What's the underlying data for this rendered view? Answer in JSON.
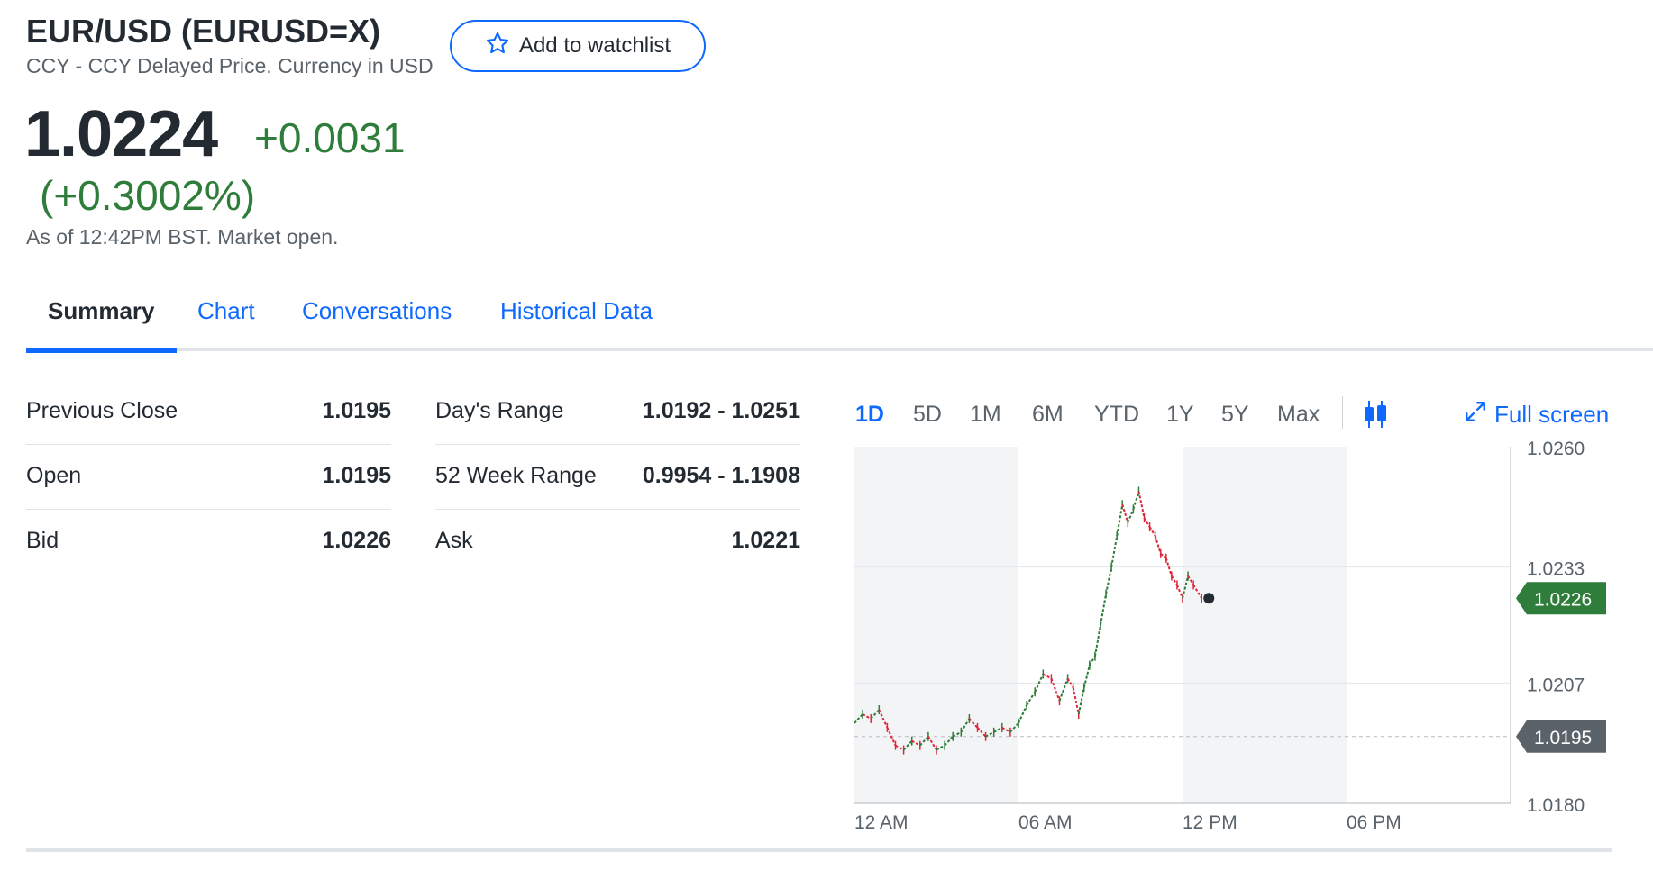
{
  "header": {
    "title": "EUR/USD (EURUSD=X)",
    "subtitle": "CCY - CCY Delayed Price. Currency in USD",
    "watchlist_label": "Add to watchlist",
    "price": "1.0224",
    "change": "+0.0031",
    "change_pct": "(+0.3002%)",
    "as_of": "As of 12:42PM BST. Market open.",
    "up_color": "#2f7d3a"
  },
  "tabs": [
    {
      "label": "Summary"
    },
    {
      "label": "Chart"
    },
    {
      "label": "Conversations"
    },
    {
      "label": "Historical Data"
    }
  ],
  "stats_left": [
    {
      "label": "Previous Close",
      "value": "1.0195"
    },
    {
      "label": "Open",
      "value": "1.0195"
    },
    {
      "label": "Bid",
      "value": "1.0226"
    }
  ],
  "stats_right": [
    {
      "label": "Day's Range",
      "value": "1.0192 - 1.0251"
    },
    {
      "label": "52 Week Range",
      "value": "0.9954 - 1.1908"
    },
    {
      "label": "Ask",
      "value": "1.0221"
    }
  ],
  "chart_toolbar": {
    "ranges": [
      "1D",
      "5D",
      "1M",
      "6M",
      "YTD",
      "1Y",
      "5Y",
      "Max"
    ],
    "active_range": "1D",
    "chart_type_icon": "candlestick-icon",
    "fullscreen_label": "Full screen"
  },
  "chart_data": {
    "type": "line",
    "xlabel": "",
    "ylabel": "",
    "x_ticks": [
      "12 AM",
      "06 AM",
      "12 PM",
      "06 PM"
    ],
    "y_ticks": [
      "1.0260",
      "1.0233",
      "1.0207",
      "1.0180"
    ],
    "ylim": [
      1.018,
      1.026
    ],
    "current_price_label": "1.0226",
    "previous_close_label": "1.0195",
    "current_price": 1.0226,
    "previous_close": 1.0195,
    "x_hours": [
      0,
      0.3,
      0.6,
      0.9,
      1.2,
      1.5,
      1.8,
      2.1,
      2.4,
      2.7,
      3.0,
      3.3,
      3.6,
      3.9,
      4.2,
      4.5,
      4.8,
      5.1,
      5.4,
      5.7,
      6.0,
      6.3,
      6.6,
      6.9,
      7.2,
      7.5,
      7.8,
      8.0,
      8.2,
      8.4,
      8.6,
      8.8,
      9.0,
      9.2,
      9.4,
      9.6,
      9.8,
      10.0,
      10.2,
      10.4,
      10.6,
      10.8,
      11.0,
      11.2,
      11.4,
      11.6,
      11.8,
      12.0,
      12.2,
      12.4,
      12.7
    ],
    "y_values": [
      1.0198,
      1.02,
      1.0199,
      1.0201,
      1.0197,
      1.0193,
      1.0192,
      1.0194,
      1.0193,
      1.0195,
      1.0192,
      1.0193,
      1.0195,
      1.0196,
      1.0199,
      1.0197,
      1.0195,
      1.0196,
      1.0197,
      1.0196,
      1.0198,
      1.0202,
      1.0205,
      1.0209,
      1.0208,
      1.0203,
      1.0208,
      1.0206,
      1.02,
      1.0206,
      1.0211,
      1.0213,
      1.022,
      1.0227,
      1.0233,
      1.024,
      1.0247,
      1.0243,
      1.0246,
      1.025,
      1.0244,
      1.0242,
      1.024,
      1.0236,
      1.0235,
      1.0231,
      1.0229,
      1.0226,
      1.0231,
      1.0229,
      1.0226
    ],
    "shaded_bands_hours": [
      [
        0,
        6
      ],
      [
        12,
        18
      ]
    ],
    "x_range_hours": [
      0,
      24
    ],
    "up_color": "#2f7d3a",
    "down_color": "#e0263b",
    "prev_close_tag_color": "#5b636a"
  }
}
